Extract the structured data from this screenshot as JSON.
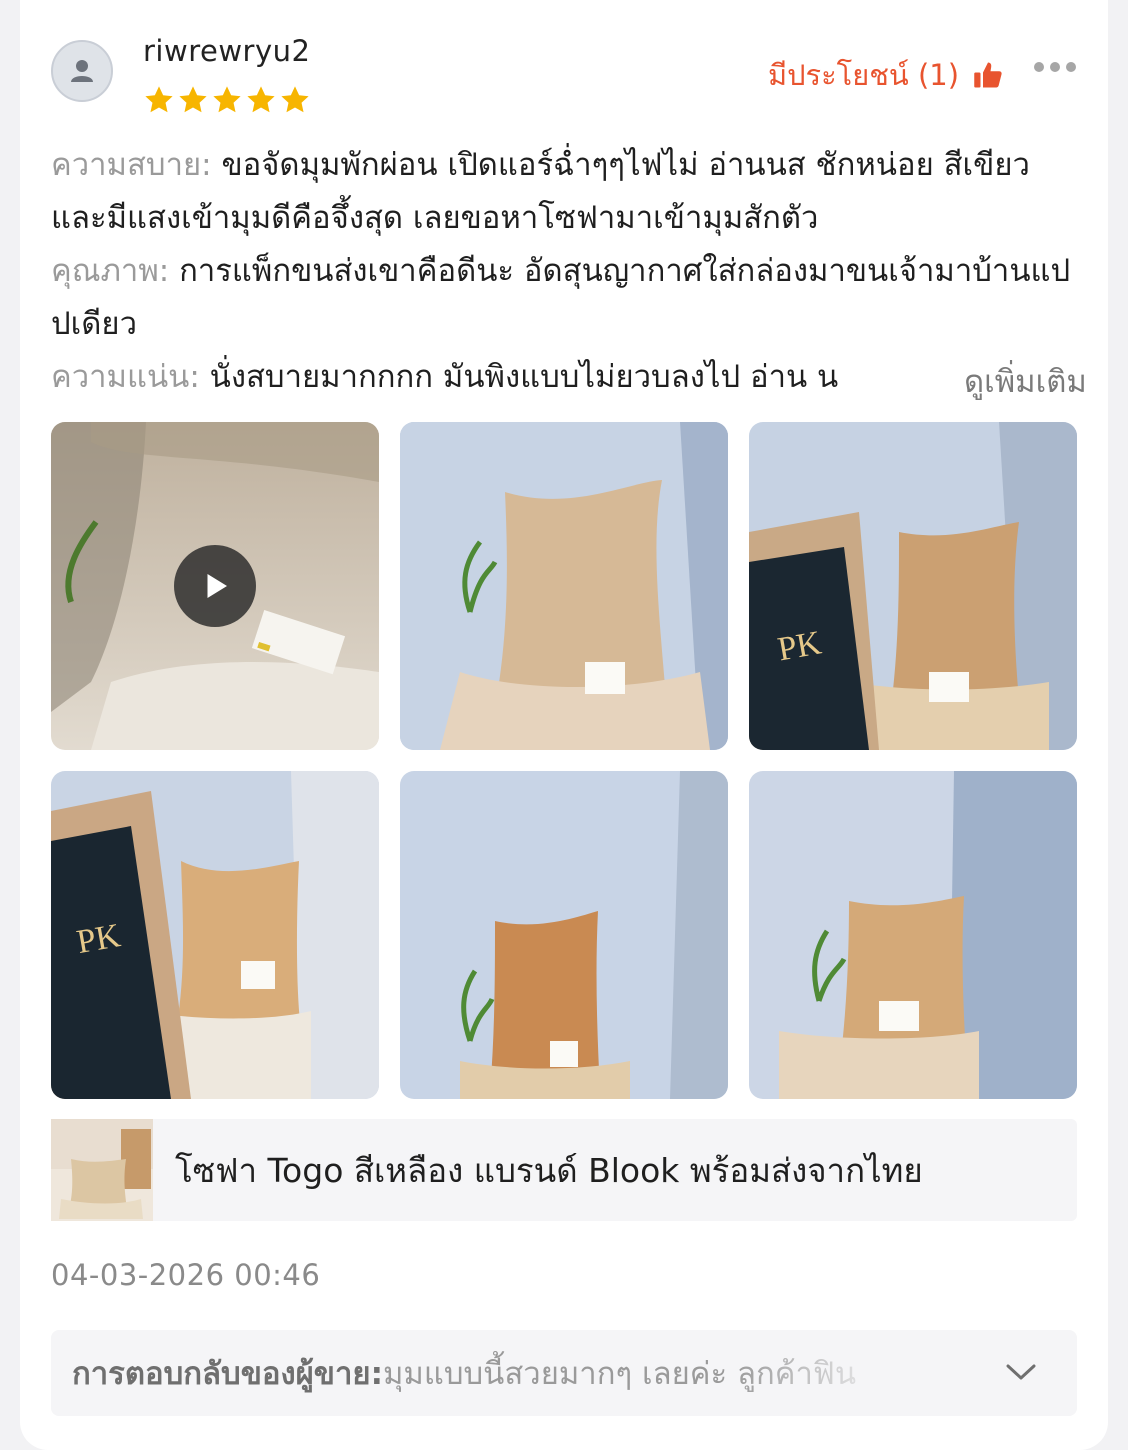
{
  "review": {
    "username": "riwrewryu2",
    "rating": 5,
    "helpful_label": "มีประโยชน์ (1)",
    "sections": [
      {
        "label": "ความสบาย:",
        "text": " ขอจัดมุมพักผ่อน เปิดแอร์ฉ่ำๆๆไฟไม่ อ่านนส ชักหน่อย สีเขียว และมีแสงเข้ามุมดีคือจึ้งสุด เลยขอหาโซฟามาเข้ามุมสักตัว"
      },
      {
        "label": "คุณภาพ:",
        "text": " การแพ็กขนส่งเขาคือดีนะ อัดสุนญากาศใส่กล่องมาขนเจ้ามาบ้านแปปเดียว"
      },
      {
        "label": "ความแน่น:",
        "text": " นั่งสบายมากกกก มันพิงแบบไม่ยวบลงไป อ่าน น"
      }
    ],
    "see_more_label": "ดูเพิ่มเติม",
    "date": "04-03-2026 00:46"
  },
  "media": [
    {
      "type": "video",
      "name": "video-thumbnail"
    },
    {
      "type": "photo",
      "name": "review-photo-2"
    },
    {
      "type": "photo",
      "name": "review-photo-3"
    },
    {
      "type": "photo",
      "name": "review-photo-4"
    },
    {
      "type": "photo",
      "name": "review-photo-5"
    },
    {
      "type": "photo",
      "name": "review-photo-6"
    }
  ],
  "product": {
    "name": "โซฟา Togo สีเหลือง แบรนด์ Blook พร้อมส่งจากไทย"
  },
  "seller_reply": {
    "label": "การตอบกลับของผู้ขาย:",
    "text": " มุมแบบนี้สวยมากๆ เลยค่ะ ลูกค้าฟิน"
  },
  "colors": {
    "accent": "#e8542f",
    "star": "#f7b500",
    "label_gray": "#9a9a9a"
  },
  "icons": [
    "user-icon",
    "star-icon",
    "thumbs-up-icon",
    "more-icon",
    "play-icon",
    "chevron-down-icon"
  ]
}
